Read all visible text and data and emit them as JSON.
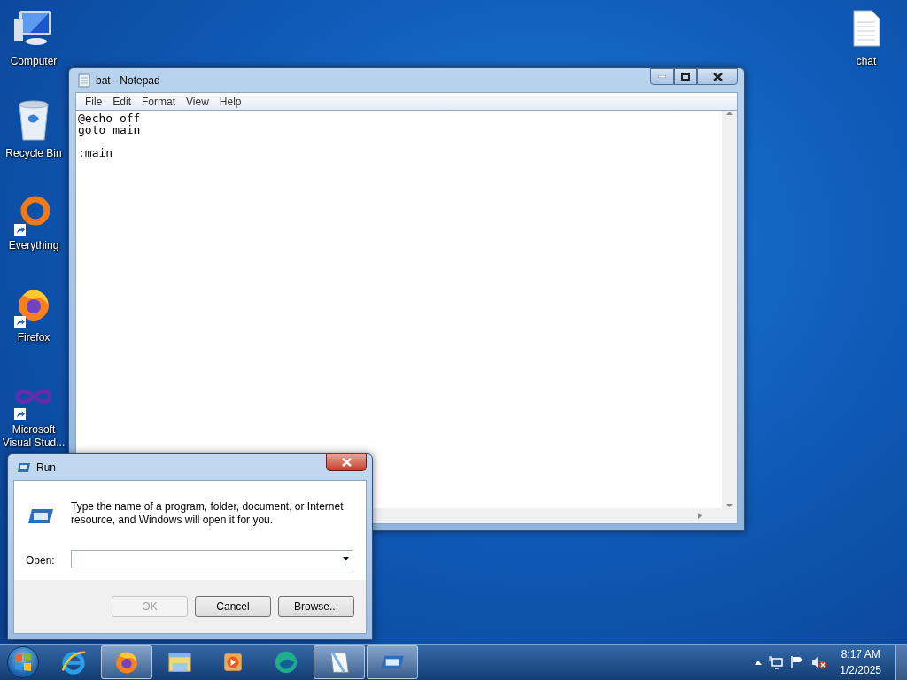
{
  "desktop_icons": [
    {
      "label": "Computer",
      "kind": "computer",
      "shortcut": false
    },
    {
      "label": "Recycle Bin",
      "kind": "bin",
      "shortcut": false
    },
    {
      "label": "Everything",
      "kind": "ring",
      "shortcut": true
    },
    {
      "label": "Firefox",
      "kind": "firefox",
      "shortcut": true
    },
    {
      "label": "Microsoft Visual Stud...",
      "kind": "infinity",
      "shortcut": true
    }
  ],
  "desktop_icons_right": [
    {
      "label": "chat",
      "kind": "document",
      "shortcut": false
    }
  ],
  "notepad": {
    "title": "bat - Notepad",
    "menu": [
      "File",
      "Edit",
      "Format",
      "View",
      "Help"
    ],
    "text": "@echo off\ngoto main\n\n:main"
  },
  "run_dialog": {
    "title": "Run",
    "description": "Type the name of a program, folder, document, or Internet resource, and Windows will open it for you.",
    "open_label": "Open:",
    "buttons": [
      {
        "label": "OK",
        "disabled": true
      },
      {
        "label": "Cancel",
        "disabled": false
      },
      {
        "label": "Browse...",
        "disabled": false
      }
    ]
  },
  "taskbar": {
    "items": [
      {
        "kind": "ie",
        "active": false
      },
      {
        "kind": "firefox",
        "active": true
      },
      {
        "kind": "explorer",
        "active": false
      },
      {
        "kind": "media",
        "active": false
      },
      {
        "kind": "globe",
        "active": false
      },
      {
        "kind": "notepad",
        "active": true
      },
      {
        "kind": "run",
        "active": true
      }
    ],
    "time": "8:17 AM",
    "date": "1/2/2025"
  }
}
